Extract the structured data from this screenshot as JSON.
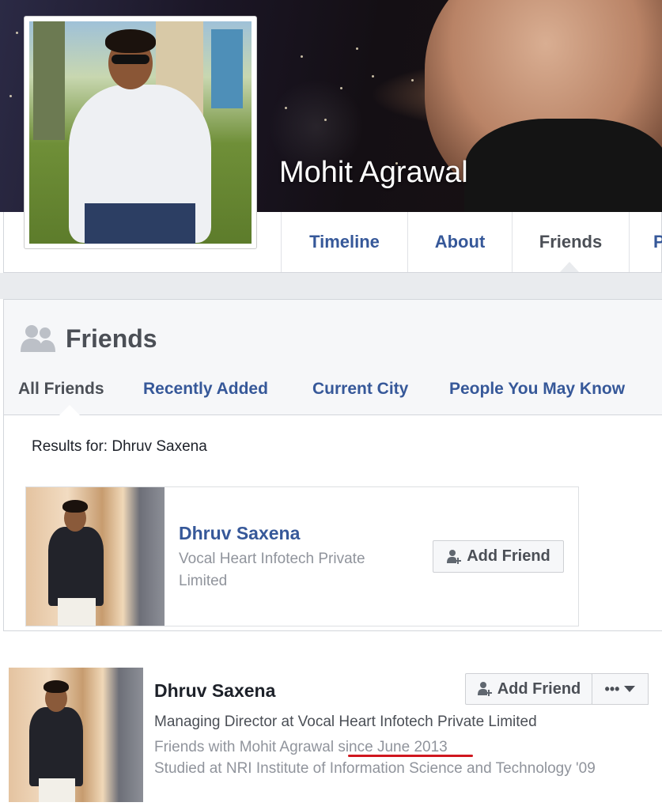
{
  "profile": {
    "name": "Mohit Agrawal"
  },
  "nav": {
    "tabs": [
      {
        "label": "Timeline"
      },
      {
        "label": "About"
      },
      {
        "label": "Friends"
      },
      {
        "label": "P"
      }
    ],
    "active": "Friends"
  },
  "friends_section": {
    "title": "Friends",
    "sub_tabs": [
      {
        "label": "All Friends"
      },
      {
        "label": "Recently Added"
      },
      {
        "label": "Current City"
      },
      {
        "label": "People You May Know"
      }
    ],
    "results_for": "Results for: Dhruv Saxena",
    "card": {
      "name": "Dhruv Saxena",
      "subtitle": "Vocal Heart Infotech Private Limited",
      "button": "Add Friend"
    }
  },
  "search_result": {
    "name": "Dhruv Saxena",
    "button": "Add Friend",
    "more_label": "•••",
    "lines": {
      "job": "Managing Director at Vocal Heart Infotech Private Limited",
      "friends_with": "Friends with Mohit Agrawal",
      "since": "since June 2013",
      "studied": "Studied at NRI Institute of Information Science and Technology '09"
    }
  },
  "colors": {
    "link_blue": "#365899",
    "dark_text": "#4b4f56",
    "muted_text": "#90949c",
    "panel_bg": "#f6f7f9",
    "underline_red": "#d0161e"
  }
}
